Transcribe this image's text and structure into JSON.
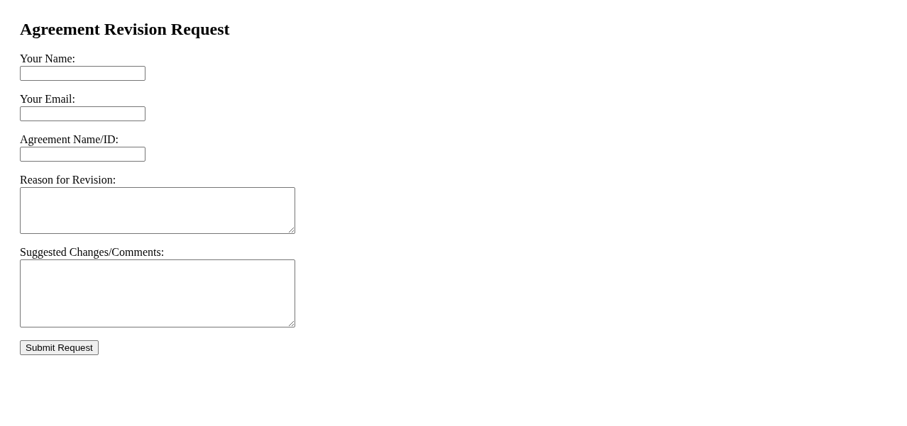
{
  "title": "Agreement Revision Request",
  "fields": [
    {
      "label": "Your Name:",
      "kind": "line"
    },
    {
      "label": "Your Email:",
      "kind": "line"
    },
    {
      "label": "Agreement Name/ID:",
      "kind": "line"
    },
    {
      "label": "Reason for Revision:",
      "kind": "box"
    },
    {
      "label": "Suggested Changes/Comments:",
      "kind": "tallbox"
    }
  ],
  "submit_button": "Submit Request"
}
